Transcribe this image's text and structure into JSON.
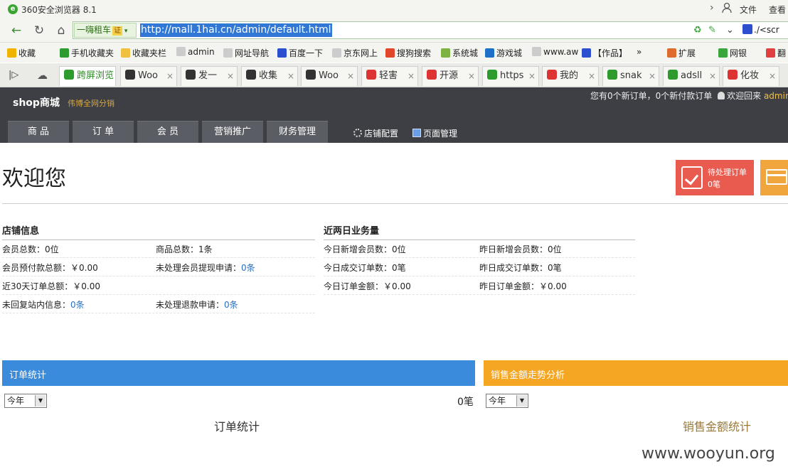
{
  "browser": {
    "title": "360安全浏览器 8.1",
    "menu_file": "文件",
    "menu_view": "查看",
    "site_label": "一嗨租车",
    "cert_label": "证",
    "url": "http://mall.1hai.cn/admin/default.html",
    "search_text": "./<scr",
    "bookmarks": [
      {
        "label": "收藏",
        "icon": "star-icon",
        "color": "#f0b400"
      },
      {
        "label": "手机收藏夹",
        "icon": "phone-icon",
        "color": "#2e9b2e"
      },
      {
        "label": "收藏夹栏",
        "icon": "folder-icon",
        "color": "#f0c040"
      },
      {
        "label": "admin",
        "icon": "page-icon",
        "color": "#cccccc"
      },
      {
        "label": "网址导航",
        "icon": "page-icon",
        "color": "#cccccc"
      },
      {
        "label": "百度一下",
        "icon": "baidu-paw-icon",
        "color": "#2b4fcf"
      },
      {
        "label": "京东网上",
        "icon": "page-icon",
        "color": "#cccccc"
      },
      {
        "label": "搜狗搜索",
        "icon": "sogou-icon",
        "color": "#e0472a"
      },
      {
        "label": "系统城",
        "icon": "circle-icon",
        "color": "#7cb342"
      },
      {
        "label": "游戏城",
        "icon": "game-icon",
        "color": "#1e6fc8"
      },
      {
        "label": "www.aw",
        "icon": "page-icon",
        "color": "#cccccc"
      },
      {
        "label": "【作品】",
        "icon": "baidu-paw-icon",
        "color": "#2b4fcf"
      },
      {
        "label": "扩展",
        "icon": "grid-icon",
        "color": "#e06b2e"
      },
      {
        "label": "网银",
        "icon": "shield-icon",
        "color": "#3aa53a"
      },
      {
        "label": "翻",
        "icon": "translate-icon",
        "color": "#e04040"
      }
    ],
    "tabs": [
      {
        "label": "跨屏浏览",
        "icon": "phone-icon",
        "color": "#2e9b2e"
      },
      {
        "label": "Woo",
        "icon": "wooyun-icon",
        "color": "#333333"
      },
      {
        "label": "发一",
        "icon": "wooyun-icon",
        "color": "#333333"
      },
      {
        "label": "收集",
        "icon": "wooyun-icon",
        "color": "#333333"
      },
      {
        "label": "Woo",
        "icon": "wooyun-icon",
        "color": "#333333"
      },
      {
        "label": "轻害",
        "icon": "qing-icon",
        "color": "#d33"
      },
      {
        "label": "开源",
        "icon": "c-icon",
        "color": "#d33"
      },
      {
        "label": "https",
        "icon": "c-icon",
        "color": "#2e9b2e"
      },
      {
        "label": "我的",
        "icon": "c-icon",
        "color": "#d33"
      },
      {
        "label": "snak",
        "icon": "c-icon",
        "color": "#2e9b2e"
      },
      {
        "label": "adsll",
        "icon": "c-icon",
        "color": "#2e9b2e"
      },
      {
        "label": "化妆",
        "icon": "qing-icon",
        "color": "#d33"
      }
    ]
  },
  "shop": {
    "brand": "shop商城",
    "brand_sub": "伟博全网分销",
    "notice": "您有0个新订单，0个新付款订单",
    "welcome_back": "欢迎回来",
    "admin": "admin",
    "nav": [
      "商 品",
      "订 单",
      "会 员",
      "营销推广",
      "财务管理"
    ],
    "tools": [
      "店铺配置",
      "页面管理"
    ]
  },
  "welcome": "欢迎您",
  "pending_card": {
    "label": "待处理订单",
    "value": "0笔"
  },
  "store_info": {
    "title": "店铺信息",
    "rows": [
      [
        {
          "label": "会员总数：",
          "value": "0位"
        },
        {
          "label": "商品总数：",
          "value": "1条"
        }
      ],
      [
        {
          "label": "会员预付款总额：",
          "value": "￥0.00"
        },
        {
          "label": "未处理会员提现申请：",
          "value": "0条"
        }
      ],
      [
        {
          "label": "近30天订单总额：",
          "value": "￥0.00"
        },
        null
      ],
      [
        {
          "label": "未回复站内信息：",
          "value": "0条"
        },
        {
          "label": "未处理退款申请：",
          "value": "0条"
        }
      ]
    ]
  },
  "recent": {
    "title": "近两日业务量",
    "rows": [
      [
        {
          "label": "今日新增会员数：",
          "value": "0位"
        },
        {
          "label": "昨日新增会员数：",
          "value": "0位"
        }
      ],
      [
        {
          "label": "今日成交订单数：",
          "value": "0笔"
        },
        {
          "label": "昨日成交订单数：",
          "value": "0笔"
        }
      ],
      [
        {
          "label": "今日订单金额：",
          "value": "￥0.00"
        },
        {
          "label": "昨日订单金额：",
          "value": "￥0.00"
        }
      ]
    ]
  },
  "order_panel": {
    "title": "订单统计",
    "period": "今年",
    "count": "0笔",
    "chart_title": "订单统计"
  },
  "sales_panel": {
    "title": "销售金额走势分析",
    "period": "今年",
    "chart_title": "销售金额统计"
  },
  "watermark": "www.wooyun.org"
}
